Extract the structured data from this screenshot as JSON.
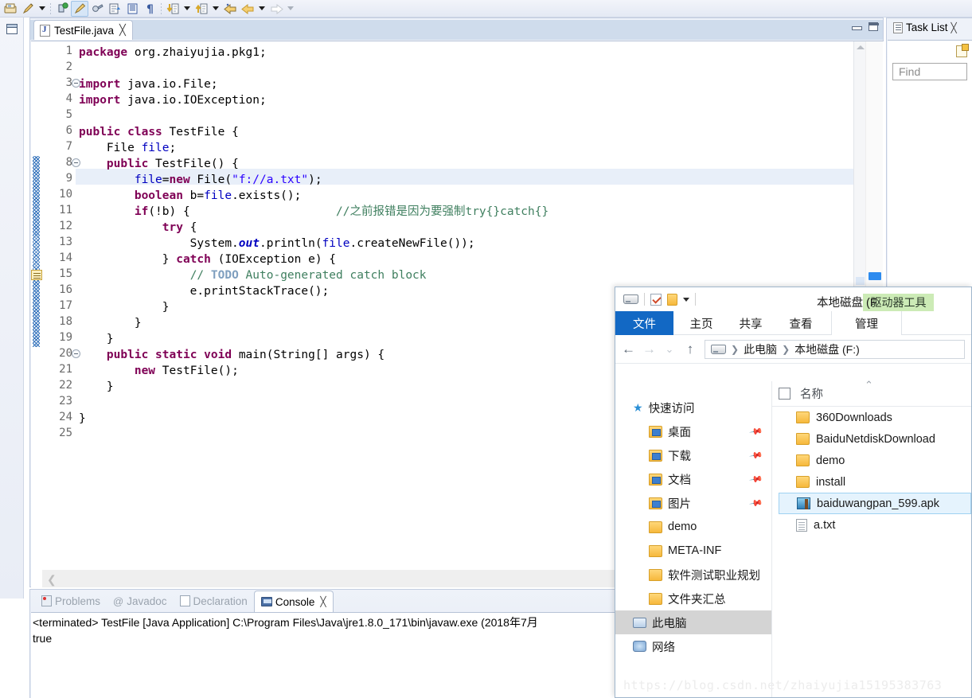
{
  "eclipse": {
    "toolbar": {
      "icons": [
        "save-icon",
        "pen-icon",
        "dropdown-arrow",
        "debug-icon",
        "run-icon",
        "external-tools-icon",
        "open-type-icon",
        "open-task-icon",
        "paragraph-icon",
        "next-annotation-icon",
        "dropdown-arrow",
        "previous-annotation-icon",
        "dropdown-arrow",
        "last-edit-icon",
        "back-icon",
        "dropdown-arrow",
        "forward-icon",
        "dropdown-arrow"
      ]
    },
    "editor": {
      "tab_label": "TestFile.java",
      "tab_close": "╳",
      "minimize_title": "Minimize",
      "maximize_title": "Maximize",
      "total_lines": 25,
      "highlighted_line": 9,
      "lines": [
        {
          "n": 1,
          "fold": false,
          "change": false,
          "todo": false
        },
        {
          "n": 2,
          "fold": false,
          "change": false,
          "todo": false
        },
        {
          "n": 3,
          "fold": true,
          "change": false,
          "todo": false
        },
        {
          "n": 4,
          "fold": false,
          "change": false,
          "todo": false
        },
        {
          "n": 5,
          "fold": false,
          "change": false,
          "todo": false
        },
        {
          "n": 6,
          "fold": false,
          "change": false,
          "todo": false
        },
        {
          "n": 7,
          "fold": false,
          "change": false,
          "todo": false
        },
        {
          "n": 8,
          "fold": true,
          "change": true,
          "todo": false
        },
        {
          "n": 9,
          "fold": false,
          "change": true,
          "todo": false
        },
        {
          "n": 10,
          "fold": false,
          "change": true,
          "todo": false
        },
        {
          "n": 11,
          "fold": false,
          "change": true,
          "todo": false
        },
        {
          "n": 12,
          "fold": false,
          "change": true,
          "todo": false
        },
        {
          "n": 13,
          "fold": false,
          "change": true,
          "todo": false
        },
        {
          "n": 14,
          "fold": false,
          "change": true,
          "todo": false
        },
        {
          "n": 15,
          "fold": false,
          "change": true,
          "todo": true
        },
        {
          "n": 16,
          "fold": false,
          "change": true,
          "todo": false
        },
        {
          "n": 17,
          "fold": false,
          "change": true,
          "todo": false
        },
        {
          "n": 18,
          "fold": false,
          "change": true,
          "todo": false
        },
        {
          "n": 19,
          "fold": false,
          "change": true,
          "todo": false
        },
        {
          "n": 20,
          "fold": true,
          "change": false,
          "todo": false
        },
        {
          "n": 21,
          "fold": false,
          "change": false,
          "todo": false
        },
        {
          "n": 22,
          "fold": false,
          "change": false,
          "todo": false
        },
        {
          "n": 23,
          "fold": false,
          "change": false,
          "todo": false
        },
        {
          "n": 24,
          "fold": false,
          "change": false,
          "todo": false
        },
        {
          "n": 25,
          "fold": false,
          "change": false,
          "todo": false
        }
      ],
      "source": [
        "package org.zhaiyujia.pkg1;",
        "",
        "import java.io.File;",
        "import java.io.IOException;",
        "",
        "public class TestFile {",
        "    File file;",
        "    public TestFile() {",
        "        file=new File(\"f://a.txt\");",
        "        boolean b=file.exists();",
        "        if(!b) {                     //之前报错是因为要强制try{}catch{}",
        "            try {",
        "                System.out.println(file.createNewFile());",
        "            } catch (IOException e) {",
        "                // TODO Auto-generated catch block",
        "                e.printStackTrace();",
        "            }",
        "        }",
        "    }",
        "    public static void main(String[] args) {",
        "        new TestFile();",
        "    }",
        "",
        "}",
        ""
      ]
    },
    "bottom_view": {
      "tabs": [
        {
          "label": "Problems",
          "icon": "problems-icon",
          "active": false
        },
        {
          "label": "Javadoc",
          "icon": "javadoc-icon",
          "active": false
        },
        {
          "label": "Declaration",
          "icon": "declaration-icon",
          "active": false
        },
        {
          "label": "Console",
          "icon": "console-icon",
          "active": true
        }
      ],
      "close_glyph": "╳",
      "header_line": "<terminated> TestFile [Java Application] C:\\Program Files\\Java\\jre1.8.0_171\\bin\\javaw.exe (2018年7月",
      "output_line": "true"
    },
    "task_list": {
      "title": "Task List",
      "close_glyph": "╳",
      "new_task_icon": "new-task-icon",
      "find_placeholder": "Find"
    }
  },
  "explorer": {
    "quick_access": {
      "drive_icon": "drive-icon",
      "properties_icon": "properties-icon",
      "new_folder_icon": "new-folder-icon",
      "customize_icon": "chevron-down-icon"
    },
    "context_tab": "驱动器工具",
    "window_title": "本地磁盘 (F",
    "ribbon_tabs": [
      {
        "label": "文件",
        "active": true
      },
      {
        "label": "主页",
        "active": false
      },
      {
        "label": "共享",
        "active": false
      },
      {
        "label": "查看",
        "active": false
      },
      {
        "label": "管理",
        "active": false,
        "contextual": true
      }
    ],
    "address": {
      "back": "←",
      "forward": "→",
      "recent": "⌄",
      "up": "↑",
      "drive_icon": "drive-icon",
      "crumbs": [
        "此电脑",
        "本地磁盘 (F:)"
      ],
      "separator": "❯"
    },
    "nav_pane": [
      {
        "label": "快速访问",
        "icon": "star-icon",
        "indent": 0,
        "pinned": false,
        "selected": false
      },
      {
        "label": "桌面",
        "icon": "folder-desktop-icon",
        "indent": 1,
        "pinned": true,
        "selected": false
      },
      {
        "label": "下载",
        "icon": "folder-downloads-icon",
        "indent": 1,
        "pinned": true,
        "selected": false
      },
      {
        "label": "文档",
        "icon": "folder-documents-icon",
        "indent": 1,
        "pinned": true,
        "selected": false
      },
      {
        "label": "图片",
        "icon": "folder-pictures-icon",
        "indent": 1,
        "pinned": true,
        "selected": false
      },
      {
        "label": "demo",
        "icon": "folder-icon",
        "indent": 1,
        "pinned": false,
        "selected": false
      },
      {
        "label": "META-INF",
        "icon": "folder-icon",
        "indent": 1,
        "pinned": false,
        "selected": false
      },
      {
        "label": "软件测试职业规划",
        "icon": "folder-icon",
        "indent": 1,
        "pinned": false,
        "selected": false
      },
      {
        "label": "文件夹汇总",
        "icon": "folder-icon",
        "indent": 1,
        "pinned": false,
        "selected": false
      },
      {
        "label": "此电脑",
        "icon": "this-pc-icon",
        "indent": 0,
        "pinned": false,
        "selected": true
      },
      {
        "label": "网络",
        "icon": "network-icon",
        "indent": 0,
        "pinned": false,
        "selected": false
      }
    ],
    "list": {
      "column_header": "名称",
      "sort_glyph": "⌃",
      "rows": [
        {
          "name": "360Downloads",
          "icon": "folder-icon",
          "selected": false
        },
        {
          "name": "BaiduNetdiskDownload",
          "icon": "folder-icon",
          "selected": false
        },
        {
          "name": "demo",
          "icon": "folder-icon",
          "selected": false
        },
        {
          "name": "install",
          "icon": "folder-icon",
          "selected": false
        },
        {
          "name": "baiduwangpan_599.apk",
          "icon": "apk-icon",
          "selected": true
        },
        {
          "name": "a.txt",
          "icon": "text-file-icon",
          "selected": false
        }
      ]
    },
    "watermark": "https://blog.csdn.net/zhaiyujia15195383763"
  }
}
